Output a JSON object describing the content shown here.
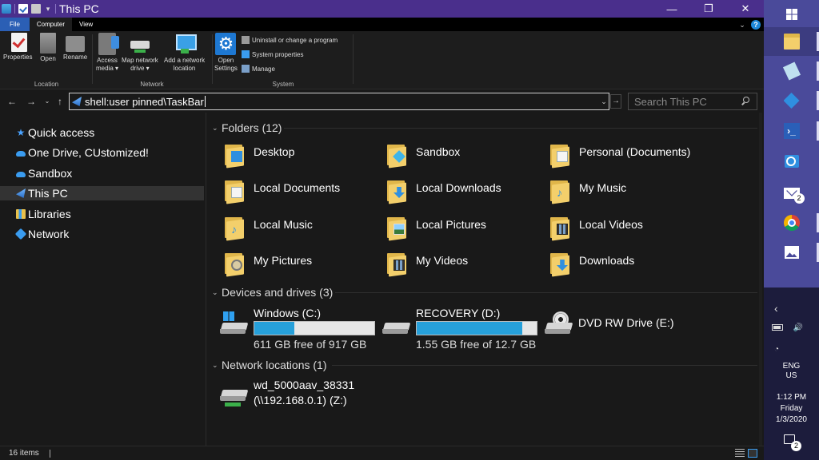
{
  "window": {
    "title": "This PC",
    "controls": {
      "minimize": "—",
      "maximize": "❐",
      "close": "✕"
    }
  },
  "ribbon": {
    "tabs": [
      "File",
      "Computer",
      "View"
    ],
    "active_tab": "Computer",
    "groups": {
      "location": {
        "label": "Location",
        "buttons": [
          {
            "label": "Properties",
            "icon": "properties-icon"
          },
          {
            "label": "Open",
            "icon": "open-icon"
          },
          {
            "label": "Rename",
            "icon": "rename-icon"
          }
        ]
      },
      "network": {
        "label": "Network",
        "buttons": [
          {
            "label": "Access\nmedia ▾",
            "icon": "access-media-icon"
          },
          {
            "label": "Map network\ndrive ▾",
            "icon": "map-drive-icon"
          },
          {
            "label": "Add a network\nlocation",
            "icon": "add-network-location-icon"
          }
        ]
      },
      "system": {
        "label": "System",
        "open_settings": "Open\nSettings",
        "items": [
          "Uninstall or change a program",
          "System properties",
          "Manage"
        ]
      }
    }
  },
  "address": {
    "path": "shell:user pinned\\TaskBar",
    "search_placeholder": "Search This PC"
  },
  "nav": {
    "items": [
      {
        "label": "Quick access",
        "icon": "star-icon"
      },
      {
        "label": "One Drive, CUstomized!",
        "icon": "cloud-icon"
      },
      {
        "label": "Sandbox",
        "icon": "cloud-icon"
      },
      {
        "label": "This PC",
        "icon": "this-pc-icon",
        "selected": true
      },
      {
        "label": "Libraries",
        "icon": "libraries-icon"
      },
      {
        "label": "Network",
        "icon": "network-icon"
      }
    ]
  },
  "content": {
    "folders_header": "Folders (12)",
    "folders": [
      {
        "name": "Desktop",
        "overlay": "desktop"
      },
      {
        "name": "Sandbox",
        "overlay": "sandbox"
      },
      {
        "name": "Personal (Documents)",
        "overlay": "doc"
      },
      {
        "name": "Local Documents",
        "overlay": "doc"
      },
      {
        "name": "Local Downloads",
        "overlay": "download"
      },
      {
        "name": "My Music",
        "overlay": "music"
      },
      {
        "name": "Local Music",
        "overlay": "music"
      },
      {
        "name": "Local Pictures",
        "overlay": "picture"
      },
      {
        "name": "Local Videos",
        "overlay": "video"
      },
      {
        "name": "My Pictures",
        "overlay": "magnifier"
      },
      {
        "name": "My Videos",
        "overlay": "video"
      },
      {
        "name": "Downloads",
        "overlay": "download"
      }
    ],
    "devices_header": "Devices and drives (3)",
    "drives": [
      {
        "name": "Windows (C:)",
        "free": "611 GB free of 917 GB",
        "used_fraction": 0.334
      },
      {
        "name": "RECOVERY (D:)",
        "free": "1.55 GB free of 12.7 GB",
        "used_fraction": 0.878
      },
      {
        "name": "DVD RW Drive (E:)"
      }
    ],
    "network_header": "Network locations (1)",
    "network_locations": [
      {
        "name": "wd_5000aav_38331",
        "path": "(\\\\192.168.0.1) (Z:)"
      }
    ]
  },
  "status": {
    "items": "16 items"
  },
  "taskbar": {
    "badges": {
      "mail": "2",
      "notifications": "2"
    },
    "tray": {
      "lang1": "ENG",
      "lang2": "US",
      "time": "1:12 PM",
      "day": "Friday",
      "date": "1/3/2020"
    }
  },
  "colors": {
    "titlebar": "#4a2f8c",
    "drive_bar": "#26a0da",
    "taskbar_top": "#4a4a9a",
    "taskbar_bottom": "#1c1c3c"
  }
}
